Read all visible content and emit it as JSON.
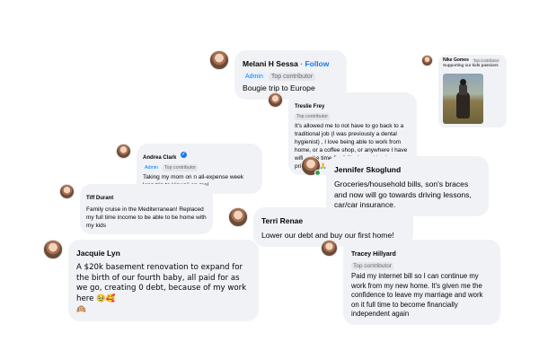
{
  "comments": {
    "melani": {
      "name": "Melani H Sessa",
      "follow": " · Follow",
      "badge_admin": "Admin",
      "badge_top": "Top contributor",
      "text": "Bougie trip to Europe"
    },
    "nike": {
      "name": "Nike Gomes",
      "badge_top": "Top contributor",
      "text": "Supporting our kids passions"
    },
    "treslie": {
      "name": "Treslie Frey",
      "badge_top": "Top contributor",
      "text": "It's allowed me to not have to go back to a traditional job (I was previously a dental hygienist) , I love being able to work from home, or a coffee shop, or anywhere I have wifi ... the time flexibility it provides is priceless 🙏"
    },
    "andrea": {
      "name": "Andrea Clark",
      "badge_admin": "Admin",
      "badge_top": "Top contributor",
      "text": "Taking my mom on n all-expense week long trip to Hawaii on me!"
    },
    "jennifer": {
      "name": "Jennifer Skoglund",
      "text": "Groceries/household bills, son's braces and now will go towards driving lessons, car/car insurance."
    },
    "tiff": {
      "name": "Tiff Durant",
      "text": "Family cruise in the Mediterranean! Replaced my full time income to be able to be home with my kids"
    },
    "terri": {
      "name": "Terri Renae",
      "text": "Lower our debt and buy our first home!"
    },
    "jacquie": {
      "name": "Jacquie Lyn",
      "text": "A $20k basement renovation to expand for the birth of our fourth baby, all paid for as we go, creating 0 debt, because of my work here 🥹🥰",
      "extra_emoji": "🙉"
    },
    "tracey": {
      "name": "Tracey Hillyard",
      "badge_top": "Top contributor",
      "text": "Paid my internet bill so I can continue my work from my new home. It's given me the confidence to leave my marriage and work on it full time to become financially independent again"
    }
  },
  "icons": {
    "verified": "✓"
  },
  "colors": {
    "bubble": "#f0f2f5",
    "link": "#1877f2",
    "admin_badge_bg": "#e7f3ff",
    "top_badge_bg": "#e4e6eb",
    "online": "#31a24c"
  }
}
